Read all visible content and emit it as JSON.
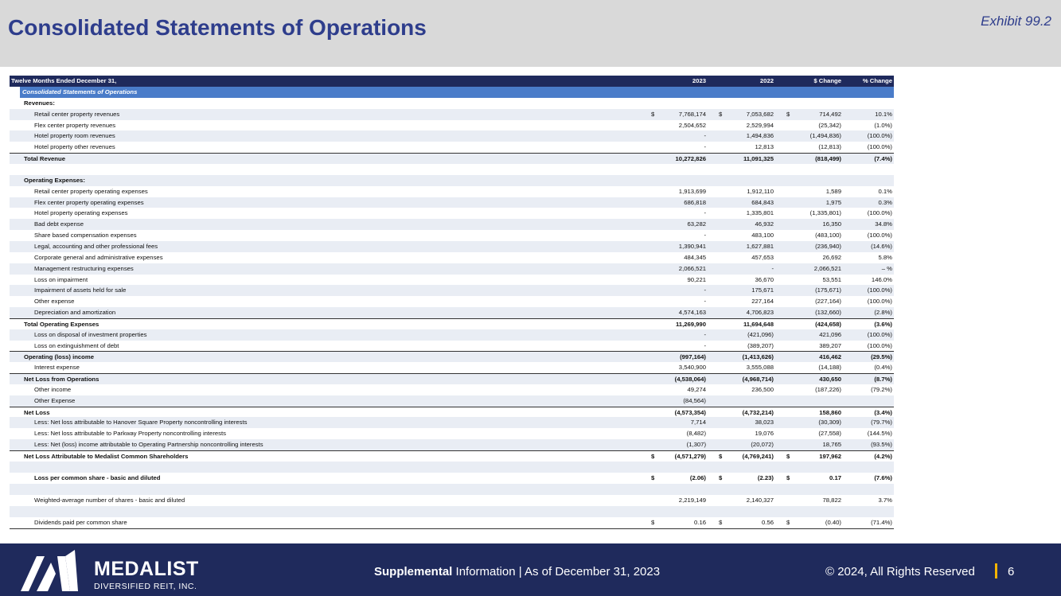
{
  "header": {
    "title": "Consolidated Statements of Operations",
    "exhibit": "Exhibit 99.2"
  },
  "table": {
    "period_label": "Twelve Months Ended December 31,",
    "col_2023": "2023",
    "col_2022": "2022",
    "col_change": "$ Change",
    "col_pct": "% Change",
    "section_title": "Consolidated Statements of Operations",
    "revenues_heading": "Revenues:",
    "opex_heading": "Operating Expenses:",
    "dollar_sign": "$",
    "rows": {
      "r1": {
        "label": "Retail center property revenues",
        "v23": "7,768,174",
        "v22": "7,053,682",
        "ch": "714,492",
        "pct": "10.1%"
      },
      "r2": {
        "label": "Flex center property revenues",
        "v23": "2,504,652",
        "v22": "2,529,994",
        "ch": "(25,342)",
        "pct": "(1.0%)"
      },
      "r3": {
        "label": "Hotel property room revenues",
        "v23": "-",
        "v22": "1,494,836",
        "ch": "(1,494,836)",
        "pct": "(100.0%)"
      },
      "r4": {
        "label": "Hotel property other revenues",
        "v23": "-",
        "v22": "12,813",
        "ch": "(12,813)",
        "pct": "(100.0%)"
      },
      "total_rev": {
        "label": "Total Revenue",
        "v23": "10,272,826",
        "v22": "11,091,325",
        "ch": "(818,499)",
        "pct": "(7.4%)"
      },
      "e1": {
        "label": "Retail center property operating expenses",
        "v23": "1,913,699",
        "v22": "1,912,110",
        "ch": "1,589",
        "pct": "0.1%"
      },
      "e2": {
        "label": "Flex center property operating expenses",
        "v23": "686,818",
        "v22": "684,843",
        "ch": "1,975",
        "pct": "0.3%"
      },
      "e3": {
        "label": "Hotel property operating expenses",
        "v23": "-",
        "v22": "1,335,801",
        "ch": "(1,335,801)",
        "pct": "(100.0%)"
      },
      "e4": {
        "label": "Bad debt expense",
        "v23": "63,282",
        "v22": "46,932",
        "ch": "16,350",
        "pct": "34.8%"
      },
      "e5": {
        "label": "Share based compensation expenses",
        "v23": "-",
        "v22": "483,100",
        "ch": "(483,100)",
        "pct": "(100.0%)"
      },
      "e6": {
        "label": "Legal, accounting and other professional fees",
        "v23": "1,390,941",
        "v22": "1,627,881",
        "ch": "(236,940)",
        "pct": "(14.6%)"
      },
      "e7": {
        "label": "Corporate general and administrative expenses",
        "v23": "484,345",
        "v22": "457,653",
        "ch": "26,692",
        "pct": "5.8%"
      },
      "e8": {
        "label": "Management restructuring expenses",
        "v23": "2,066,521",
        "v22": "-",
        "ch": "2,066,521",
        "pct": "– %"
      },
      "e9": {
        "label": "Loss on impairment",
        "v23": "90,221",
        "v22": "36,670",
        "ch": "53,551",
        "pct": "146.0%"
      },
      "e10": {
        "label": "Impairment of assets held for sale",
        "v23": "-",
        "v22": "175,671",
        "ch": "(175,671)",
        "pct": "(100.0%)"
      },
      "e11": {
        "label": "Other expense",
        "v23": "-",
        "v22": "227,164",
        "ch": "(227,164)",
        "pct": "(100.0%)"
      },
      "e12": {
        "label": "Depreciation and amortization",
        "v23": "4,574,163",
        "v22": "4,706,823",
        "ch": "(132,660)",
        "pct": "(2.8%)"
      },
      "total_opex": {
        "label": "Total Operating Expenses",
        "v23": "11,269,990",
        "v22": "11,694,648",
        "ch": "(424,658)",
        "pct": "(3.6%)"
      },
      "g1": {
        "label": "Loss on disposal of investment properties",
        "v23": "-",
        "v22": "(421,096)",
        "ch": "421,096",
        "pct": "(100.0%)"
      },
      "g2": {
        "label": "Loss on extinguishment of debt",
        "v23": "-",
        "v22": "(389,207)",
        "ch": "389,207",
        "pct": "(100.0%)"
      },
      "op_income": {
        "label": "Operating (loss) income",
        "v23": "(997,164)",
        "v22": "(1,413,626)",
        "ch": "416,462",
        "pct": "(29.5%)"
      },
      "interest": {
        "label": "Interest expense",
        "v23": "3,540,900",
        "v22": "3,555,088",
        "ch": "(14,188)",
        "pct": "(0.4%)"
      },
      "net_ops": {
        "label": "Net Loss from Operations",
        "v23": "(4,538,064)",
        "v22": "(4,968,714)",
        "ch": "430,650",
        "pct": "(8.7%)"
      },
      "other_inc": {
        "label": "Other income",
        "v23": "49,274",
        "v22": "236,500",
        "ch": "(187,226)",
        "pct": "(79.2%)"
      },
      "other_exp": {
        "label": "Other Expense",
        "v23": "(84,564)",
        "v22": "",
        "ch": "",
        "pct": ""
      },
      "net_loss": {
        "label": "Net Loss",
        "v23": "(4,573,354)",
        "v22": "(4,732,214)",
        "ch": "158,860",
        "pct": "(3.4%)"
      },
      "nci1": {
        "label": "Less: Net loss attributable to Hanover Square Property noncontrolling interests",
        "v23": "7,714",
        "v22": "38,023",
        "ch": "(30,309)",
        "pct": "(79.7%)"
      },
      "nci2": {
        "label": "Less: Net loss attributable to Parkway Property noncontrolling interests",
        "v23": "(8,482)",
        "v22": "19,076",
        "ch": "(27,558)",
        "pct": "(144.5%)"
      },
      "nci3": {
        "label": "Less: Net (loss) income attributable to Operating Partnership noncontrolling interests",
        "v23": "(1,307)",
        "v22": "(20,072)",
        "ch": "18,765",
        "pct": "(93.5%)"
      },
      "net_common": {
        "label": "Net Loss Attributable to Medalist Common Shareholders",
        "v23": "(4,571,279)",
        "v22": "(4,769,241)",
        "ch": "197,962",
        "pct": "(4.2%)"
      },
      "eps": {
        "label": "Loss per common share - basic and diluted",
        "v23": "(2.06)",
        "v22": "(2.23)",
        "ch": "0.17",
        "pct": "(7.6%)"
      },
      "shares": {
        "label": "Weighted-average number of shares - basic and diluted",
        "v23": "2,219,149",
        "v22": "2,140,327",
        "ch": "78,822",
        "pct": "3.7%"
      },
      "divs": {
        "label": "Dividends paid per common share",
        "v23": "0.16",
        "v22": "0.56",
        "ch": "(0.40)",
        "pct": "(71.4%)"
      }
    }
  },
  "footer": {
    "brand": "MEDALIST",
    "brand_sub": "DIVERSIFIED REIT, INC.",
    "supplemental_bold": "Supplemental",
    "supplemental_rest": " Information | As of December 31, 2023",
    "copyright": "© 2024, All Rights Reserved",
    "page": "6",
    "bg_color": "#1f2a5c",
    "accent_color": "#f4b400"
  }
}
